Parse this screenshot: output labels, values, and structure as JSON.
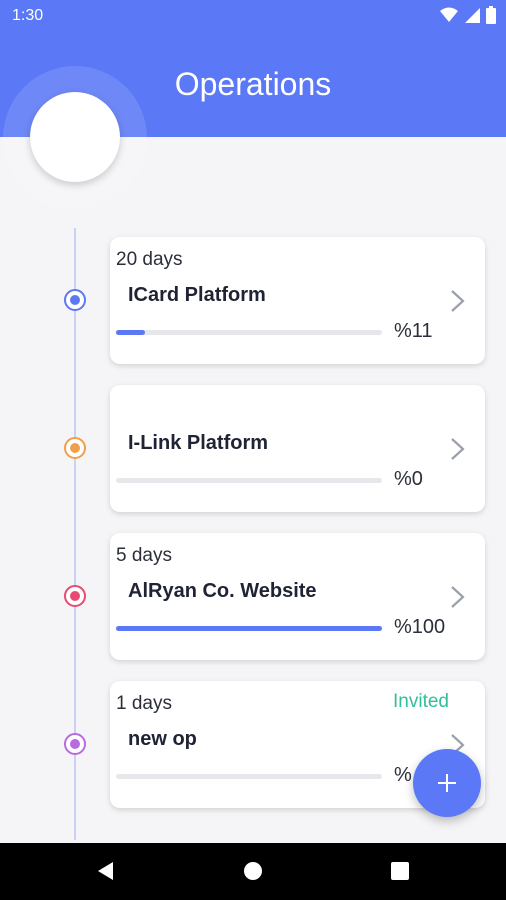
{
  "status_bar": {
    "time": "1:30",
    "icons": [
      "wifi-icon",
      "signal-icon",
      "battery-icon"
    ]
  },
  "header": {
    "title": "Operations",
    "color": "#5b78f6"
  },
  "operations": [
    {
      "days": "20 days",
      "name": "ICard Platform",
      "status": "",
      "progress": 0.11,
      "percent_label": "%11",
      "dot_color": "#5b78f6"
    },
    {
      "days": "",
      "name": "I-Link Platform",
      "status": "",
      "progress": 0.0,
      "percent_label": "%0",
      "dot_color": "#f0a04b"
    },
    {
      "days": "5 days",
      "name": "AlRyan Co. Website",
      "status": "",
      "progress": 1.0,
      "percent_label": "%100",
      "dot_color": "#e84a72"
    },
    {
      "days": "1 days",
      "name": "new op",
      "status": "Invited",
      "progress": 0.0,
      "percent_label": "%",
      "dot_color": "#b86ae0"
    }
  ],
  "fab": {
    "icon": "plus-icon"
  },
  "nav_bar": {
    "icons": [
      "back-icon",
      "home-icon",
      "recents-icon"
    ]
  }
}
